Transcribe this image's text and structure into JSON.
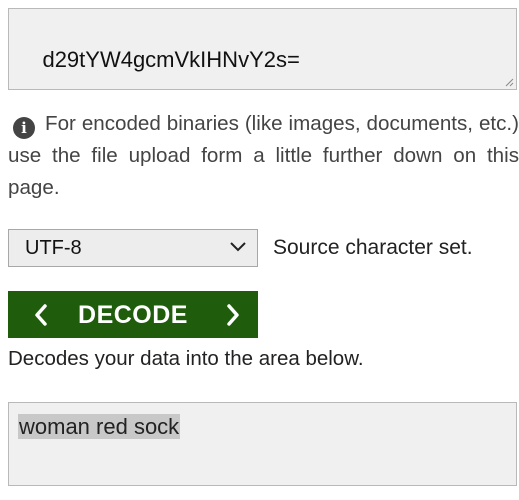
{
  "input": {
    "value": "d29tYW4gcmVkIHNvY2s="
  },
  "info": {
    "icon": "info-circle-icon",
    "glyph": "i",
    "text": "For encoded binaries (like images, documents, etc.) use the file upload form a little further down on this page."
  },
  "charset": {
    "selected": "UTF-8",
    "label": "Source character set."
  },
  "decode": {
    "label": "DECODE",
    "help": "Decodes your data into the area below.",
    "color": "#1f5d0d"
  },
  "output": {
    "value": "woman red sock"
  }
}
